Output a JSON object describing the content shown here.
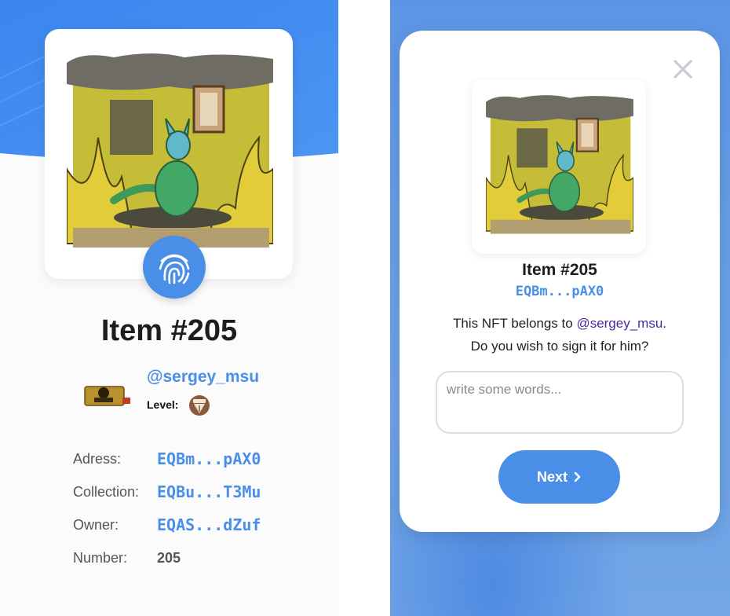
{
  "left": {
    "item_title": "Item #205",
    "owner": {
      "handle": "@sergey_msu",
      "level_label": "Level:"
    },
    "info": [
      {
        "label": "Adress:",
        "value": "EQBm...pAX0"
      },
      {
        "label": "Collection:",
        "value": "EQBu...T3Mu"
      },
      {
        "label": "Owner:",
        "value": "EQAS...dZuf"
      },
      {
        "label": "Number:",
        "value": "205"
      }
    ]
  },
  "modal": {
    "title": "Item #205",
    "address": "EQBm...pAX0",
    "message_prefix": "This NFT belongs to ",
    "message_handle": "@sergey_msu",
    "message_suffix": ".",
    "message_line2": "Do you wish to sign it for him?",
    "input_placeholder": "write some words...",
    "next_label": "Next",
    "next_icon": "chevron-right-icon",
    "close_icon": "close-icon"
  },
  "colors": {
    "accent": "#4a8fe7",
    "handle_purple": "#4b2aa0",
    "text_dark": "#1d1d1f",
    "label_gray": "#555555",
    "right_bg": "#6a9ee0"
  }
}
